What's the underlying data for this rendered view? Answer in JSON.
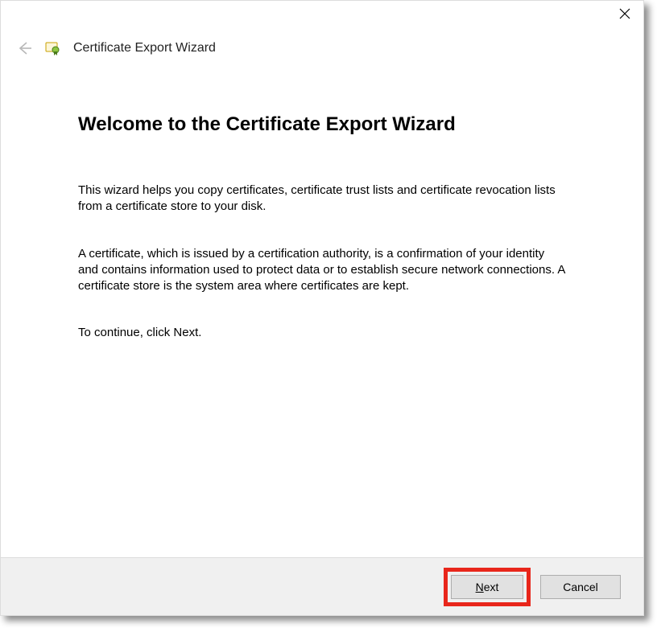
{
  "header": {
    "title": "Certificate Export Wizard"
  },
  "content": {
    "heading": "Welcome to the Certificate Export Wizard",
    "para1": "This wizard helps you copy certificates, certificate trust lists and certificate revocation lists from a certificate store to your disk.",
    "para2": "A certificate, which is issued by a certification authority, is a confirmation of your identity and contains information used to protect data or to establish secure network connections. A certificate store is the system area where certificates are kept.",
    "para3": "To continue, click Next."
  },
  "footer": {
    "next_prefix": "N",
    "next_suffix": "ext",
    "cancel": "Cancel"
  }
}
